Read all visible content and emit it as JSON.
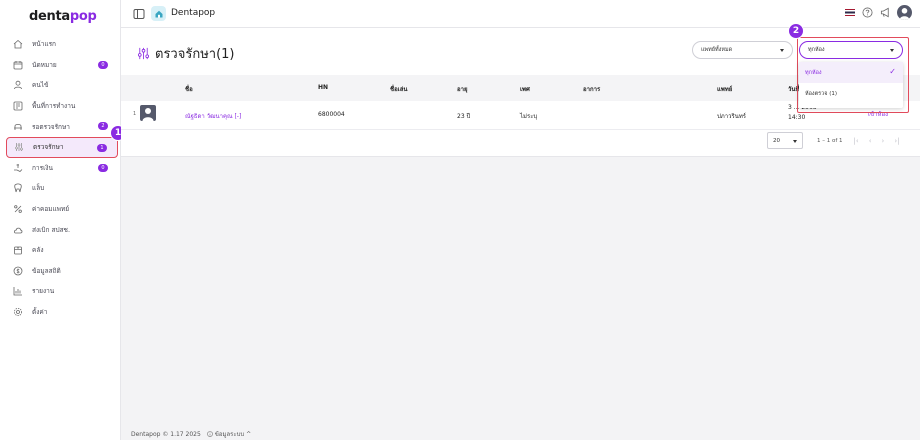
{
  "app": {
    "logo_prefix": "denta",
    "logo_suffix": "pop",
    "clinic_name": "Dentapop"
  },
  "sidebar": {
    "items": [
      {
        "label": "หน้าแรก",
        "icon": "home-icon",
        "badge": ""
      },
      {
        "label": "นัดหมาย",
        "icon": "calendar-icon",
        "badge": "0"
      },
      {
        "label": "คนไข้",
        "icon": "user-icon",
        "badge": ""
      },
      {
        "label": "พื้นที่การทำงาน",
        "icon": "workspace-icon",
        "badge": ""
      },
      {
        "label": "รอตรวจรักษา",
        "icon": "waiting-chair-icon",
        "badge": "2"
      },
      {
        "label": "ตรวจรักษา",
        "icon": "sliders-icon",
        "badge": "1"
      },
      {
        "label": "การเงิน",
        "icon": "payment-hand-icon",
        "badge": "0"
      },
      {
        "label": "แล็บ",
        "icon": "tooth-icon",
        "badge": ""
      },
      {
        "label": "ค่าคอมแพทย์",
        "icon": "percent-icon",
        "badge": ""
      },
      {
        "label": "ส่งเบิก สปสช.",
        "icon": "cloud-icon",
        "badge": ""
      },
      {
        "label": "คลัง",
        "icon": "inventory-icon",
        "badge": ""
      },
      {
        "label": "ข้อมูลสถิติ",
        "icon": "dollar-circle-icon",
        "badge": ""
      },
      {
        "label": "รายงาน",
        "icon": "chart-icon",
        "badge": ""
      },
      {
        "label": "ตั้งค่า",
        "icon": "gear-icon",
        "badge": ""
      }
    ],
    "active_index": 5
  },
  "callouts": [
    "1",
    "2"
  ],
  "page": {
    "title": "ตรวจรักษา(1)"
  },
  "filters": {
    "doctor_select": "แพทย์ทั้งหมด",
    "room_select": "ทุกห้อง",
    "room_options": [
      {
        "label": "ทุกห้อง",
        "selected": true
      },
      {
        "label": "ห้องตรวจ (1)",
        "selected": false
      }
    ]
  },
  "table": {
    "columns": [
      "ชื่อ",
      "HN",
      "ชื่อเล่น",
      "อายุ",
      "เพศ",
      "อาการ",
      "แพทย์",
      "วันที่"
    ],
    "rows": [
      {
        "index": "1",
        "name": "ณัฐธิดา วัฒนาคุณ [-]",
        "hn": "6800004",
        "nickname": "",
        "age": "23 ปี",
        "gender": "ไม่ระบุ",
        "symptom": "",
        "doctor": "ปภาวรินทร์",
        "date": "3 ... 2568",
        "time": "14:30",
        "action": "เข้าห้อง"
      }
    ]
  },
  "pagination": {
    "page_size": "20",
    "info": "1 – 1 of 1"
  },
  "footer": {
    "copyright": "Dentapop © 1.17 2025",
    "info": "ข้อมูลระบบ ^"
  },
  "colors": {
    "accent": "#8a2be2",
    "highlight": "#e24b5c"
  }
}
